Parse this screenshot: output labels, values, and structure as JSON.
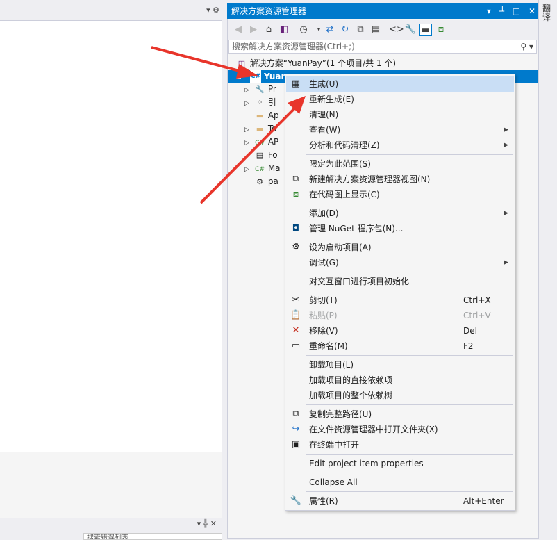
{
  "left_pane": {
    "top_controls": "▾ ⚙",
    "lower_controls": "▾ ╬ ✕",
    "bottom_search": "搜索错误列表"
  },
  "solution_explorer": {
    "title": "解决方案资源管理器",
    "title_buttons": [
      "▾",
      "ꟷ",
      "□",
      "✕"
    ],
    "search_placeholder": "搜索解决方案资源管理器(Ctrl+;)",
    "solution_label": "解决方案“YuanPay”(1 个项目/共 1 个)",
    "project_label": "Yuan",
    "tree": [
      {
        "label": "Pr",
        "expandable": true,
        "icon": "wrench-icon"
      },
      {
        "label": "引",
        "expandable": true,
        "icon": "references-icon"
      },
      {
        "label": "Ap",
        "expandable": false,
        "icon": "folder-icon"
      },
      {
        "label": "To",
        "expandable": true,
        "icon": "folder-icon"
      },
      {
        "label": "AP",
        "expandable": true,
        "icon": "csharp-icon"
      },
      {
        "label": "Fo",
        "expandable": false,
        "icon": "form-icon"
      },
      {
        "label": "Ma",
        "expandable": true,
        "icon": "csharp-icon"
      },
      {
        "label": "pa",
        "expandable": false,
        "icon": "config-icon"
      }
    ]
  },
  "sidebar": {
    "label": "翻译"
  },
  "context_menu": {
    "items": [
      {
        "label": "生成(U)",
        "icon": "build-icon",
        "shortcut": "",
        "submenu": false,
        "highlighted": true
      },
      {
        "label": "重新生成(E)",
        "icon": "",
        "shortcut": "",
        "submenu": false
      },
      {
        "label": "清理(N)",
        "icon": "",
        "shortcut": "",
        "submenu": false
      },
      {
        "label": "查看(W)",
        "icon": "",
        "shortcut": "",
        "submenu": true
      },
      {
        "label": "分析和代码清理(Z)",
        "icon": "",
        "shortcut": "",
        "submenu": true
      },
      {
        "label": "限定为此范围(S)",
        "icon": "",
        "shortcut": "",
        "submenu": false
      },
      {
        "label": "新建解决方案资源管理器视图(N)",
        "icon": "new-view-icon",
        "shortcut": "",
        "submenu": false
      },
      {
        "label": "在代码图上显示(C)",
        "icon": "code-map-icon",
        "shortcut": "",
        "submenu": false
      },
      {
        "label": "添加(D)",
        "icon": "",
        "shortcut": "",
        "submenu": true
      },
      {
        "label": "管理 NuGet 程序包(N)...",
        "icon": "nuget-icon",
        "shortcut": "",
        "submenu": false
      },
      {
        "label": "设为启动项目(A)",
        "icon": "gear-icon",
        "shortcut": "",
        "submenu": false
      },
      {
        "label": "调试(G)",
        "icon": "",
        "shortcut": "",
        "submenu": true
      },
      {
        "label": "对交互窗口进行项目初始化",
        "icon": "",
        "shortcut": "",
        "submenu": false
      },
      {
        "label": "剪切(T)",
        "icon": "scissors-icon",
        "shortcut": "Ctrl+X",
        "submenu": false
      },
      {
        "label": "粘贴(P)",
        "icon": "clipboard-icon",
        "shortcut": "Ctrl+V",
        "submenu": false,
        "disabled": true
      },
      {
        "label": "移除(V)",
        "icon": "remove-icon",
        "shortcut": "Del",
        "submenu": false
      },
      {
        "label": "重命名(M)",
        "icon": "rename-icon",
        "shortcut": "F2",
        "submenu": false
      },
      {
        "label": "卸载项目(L)",
        "icon": "",
        "shortcut": "",
        "submenu": false
      },
      {
        "label": "加载项目的直接依赖项",
        "icon": "",
        "shortcut": "",
        "submenu": false
      },
      {
        "label": "加载项目的整个依赖树",
        "icon": "",
        "shortcut": "",
        "submenu": false
      },
      {
        "label": "复制完整路径(U)",
        "icon": "copy-icon",
        "shortcut": "",
        "submenu": false
      },
      {
        "label": "在文件资源管理器中打开文件夹(X)",
        "icon": "open-folder-icon",
        "shortcut": "",
        "submenu": false
      },
      {
        "label": "在终端中打开",
        "icon": "terminal-icon",
        "shortcut": "",
        "submenu": false
      },
      {
        "label": "Edit project item properties",
        "icon": "",
        "shortcut": "",
        "submenu": false
      },
      {
        "label": "Collapse All",
        "icon": "",
        "shortcut": "",
        "submenu": false
      },
      {
        "label": "属性(R)",
        "icon": "wrench-icon",
        "shortcut": "Alt+Enter",
        "submenu": false
      }
    ]
  },
  "colors": {
    "accent": "#007acc",
    "highlight": "#c9def5",
    "arrow": "#e8352b"
  }
}
